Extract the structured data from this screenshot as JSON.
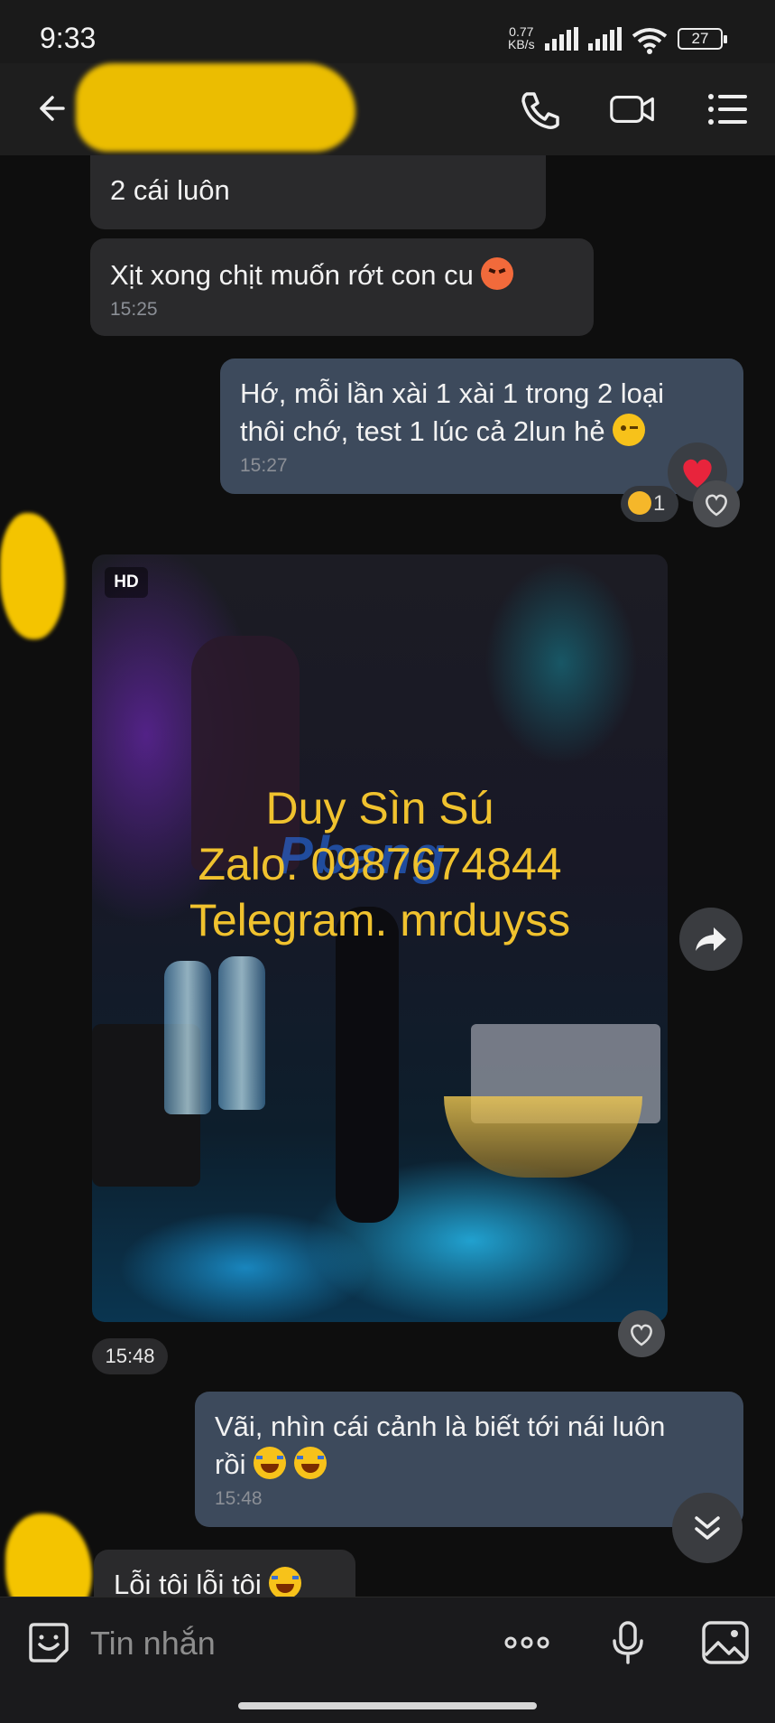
{
  "status_bar": {
    "time": "9:33",
    "net_speed_value": "0.77",
    "net_speed_unit": "KB/s",
    "battery": "27"
  },
  "header": {
    "contact_name": "",
    "icons": [
      "back-arrow-icon",
      "phone-icon",
      "video-call-icon",
      "menu-list-icon"
    ]
  },
  "messages": [
    {
      "direction": "in",
      "text": "2 cái luôn",
      "time": ""
    },
    {
      "direction": "in",
      "text": "Xịt xong chịt muốn rớt con cu",
      "emoji": "angry-face",
      "time": "15:25"
    },
    {
      "direction": "out",
      "line1": "Hớ, mỗi lần xài 1 xài 1 trong 2 loại",
      "line2": "thôi chớ, test 1 lúc cả 2lun hẻ",
      "emoji": "wink-face",
      "time": "15:27",
      "reaction": "heart",
      "reaction_count": "1"
    },
    {
      "direction": "in",
      "type": "photo",
      "badge": "HD",
      "overlay": [
        "Duy Sìn Sú",
        "Zalo. 0987674844",
        "Telegram. mrduyss"
      ],
      "watermark": "Pbang",
      "time": "15:48"
    },
    {
      "direction": "out",
      "line1": "Vãi, nhìn cái cảnh là biết tới nái luôn",
      "line2": "rồi",
      "emoji": "laughing-tears",
      "time": "15:48"
    },
    {
      "direction": "in",
      "text": "Lỗi tôi lỗi tôi",
      "emoji": "laughing-tears"
    }
  ],
  "input": {
    "placeholder": "Tin nhắn"
  },
  "colors": {
    "background": "#0e0e0e",
    "incoming_bubble": "#2a2a2c",
    "outgoing_bubble": "#3d4a5c",
    "overlay_text": "#f0c22e",
    "heart": "#e8243c"
  }
}
